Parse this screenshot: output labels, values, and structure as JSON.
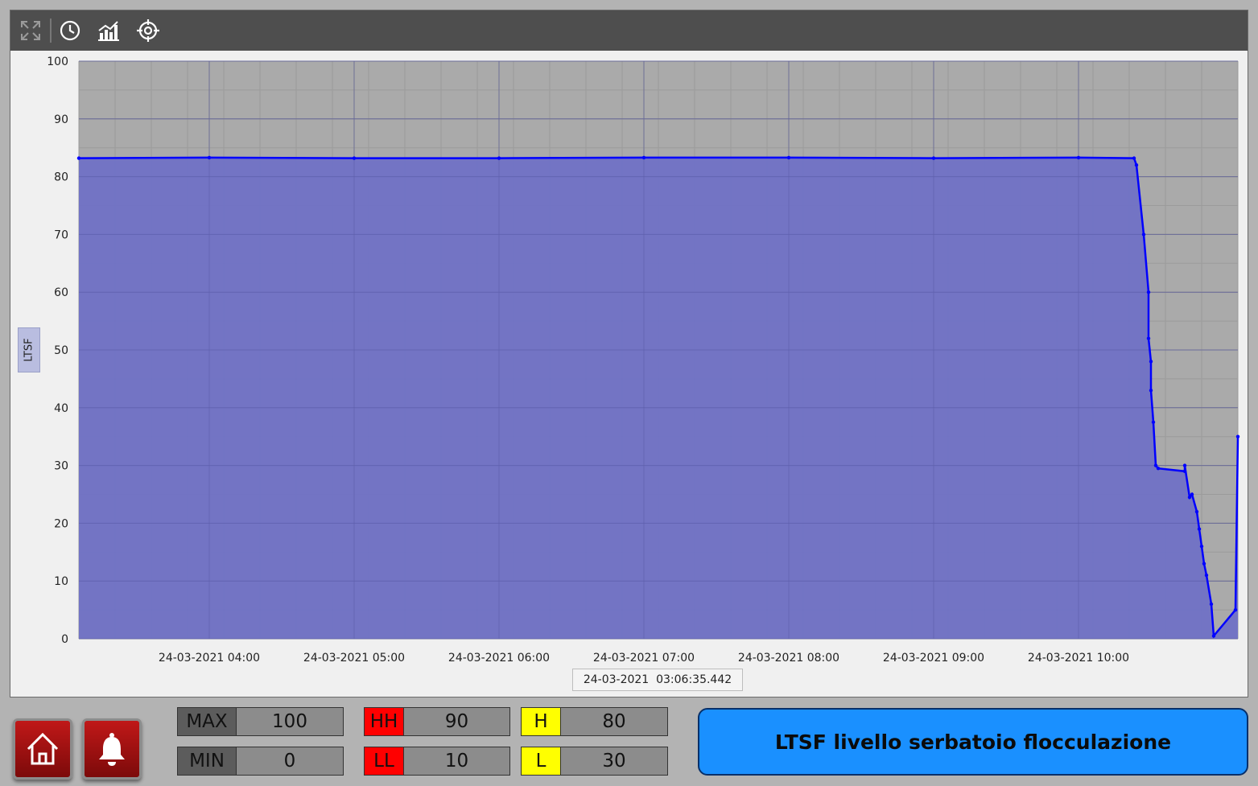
{
  "toolbar": {
    "icons": [
      "expand-icon",
      "clock-icon",
      "trend-chart-icon",
      "crosshair-icon"
    ]
  },
  "chart_data": {
    "type": "area",
    "ylabel": "LTSF",
    "ylim": [
      0,
      100
    ],
    "yticks": [
      "0",
      "10",
      "20",
      "30",
      "40",
      "50",
      "60",
      "70",
      "80",
      "90",
      "100"
    ],
    "xlim": [
      "24-03-2021 03:06",
      "24-03-2021 11:06"
    ],
    "xticks": [
      "24-03-2021 04:00",
      "24-03-2021 05:00",
      "24-03-2021 06:00",
      "24-03-2021 07:00",
      "24-03-2021 08:00",
      "24-03-2021 09:00",
      "24-03-2021 10:00"
    ],
    "grid": true,
    "colors": {
      "line": "#0000ff",
      "fill": "#6f70c6",
      "plot_bg": "#aaaaaa"
    },
    "series": [
      {
        "x": [
          "24-03-2021 03:06",
          "24-03-2021 04:00",
          "24-03-2021 05:00",
          "24-03-2021 06:00",
          "24-03-2021 07:00",
          "24-03-2021 08:00",
          "24-03-2021 09:00",
          "24-03-2021 10:00",
          "24-03-2021 10:23",
          "24-03-2021 10:24",
          "24-03-2021 10:27",
          "24-03-2021 10:29",
          "24-03-2021 10:29",
          "24-03-2021 10:30",
          "24-03-2021 10:30",
          "24-03-2021 10:31",
          "24-03-2021 10:32",
          "24-03-2021 10:33",
          "24-03-2021 10:44",
          "24-03-2021 10:44",
          "24-03-2021 10:46",
          "24-03-2021 10:47",
          "24-03-2021 10:49",
          "24-03-2021 10:50",
          "24-03-2021 10:51",
          "24-03-2021 10:52",
          "24-03-2021 10:53",
          "24-03-2021 10:55",
          "24-03-2021 10:56",
          "24-03-2021 11:05",
          "24-03-2021 11:06"
        ],
        "values": [
          83.2,
          83.3,
          83.2,
          83.2,
          83.3,
          83.3,
          83.2,
          83.3,
          83.2,
          82,
          70,
          60,
          52,
          48,
          43,
          37.5,
          30,
          29.5,
          29,
          30,
          24.5,
          25,
          22,
          19,
          16,
          13,
          11,
          6,
          0.5,
          5,
          35
        ]
      }
    ],
    "cursor_time": "24-03-2021  03:06:35.442"
  },
  "limits": {
    "max": {
      "label": "MAX",
      "value": "100"
    },
    "min": {
      "label": "MIN",
      "value": "0"
    },
    "hh": {
      "label": "HH",
      "value": "90"
    },
    "ll": {
      "label": "LL",
      "value": "10"
    },
    "h": {
      "label": "H",
      "value": "80"
    },
    "l": {
      "label": "L",
      "value": "30"
    }
  },
  "nav": {
    "home_icon": "home-icon",
    "alarm_icon": "bell-icon"
  },
  "title": "LTSF livello serbatoio flocculazione"
}
